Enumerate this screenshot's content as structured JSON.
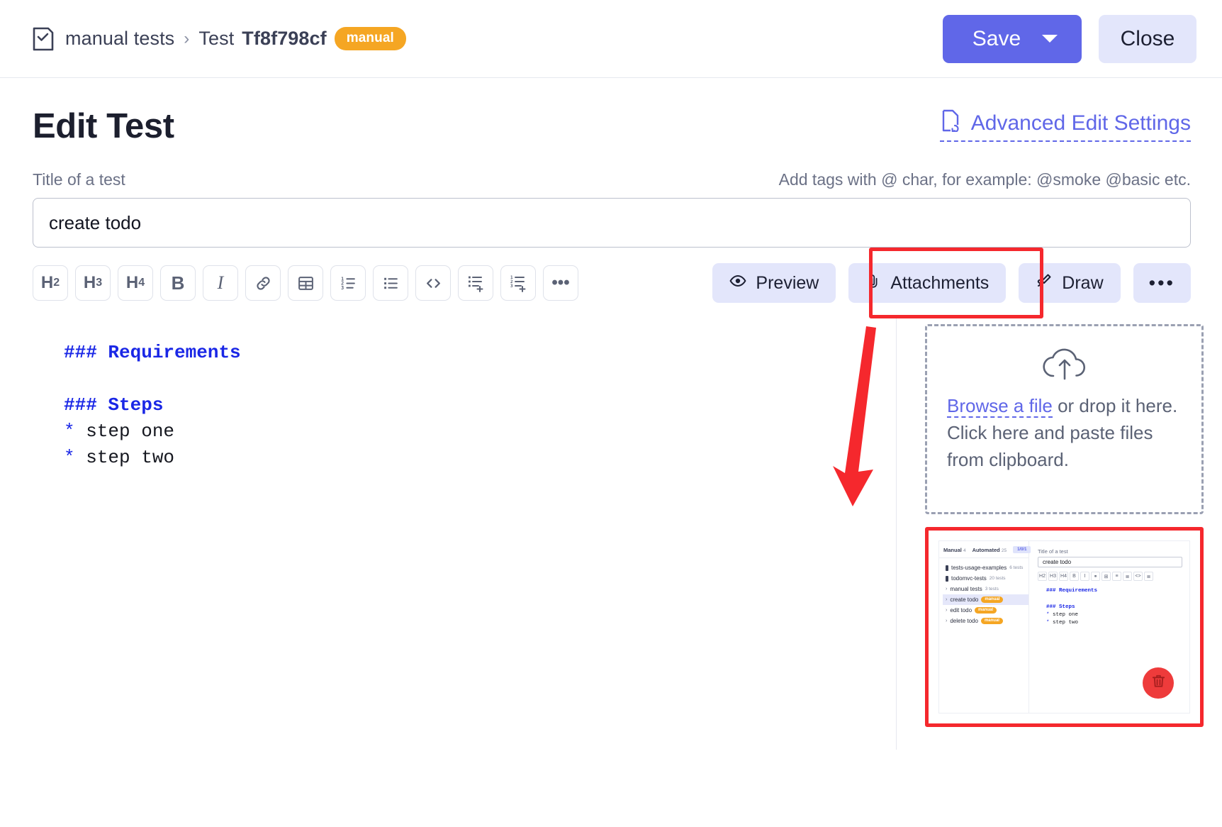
{
  "topbar": {
    "doc_icon": "checklist-doc-icon",
    "breadcrumb_root": "manual tests",
    "breadcrumb_sep": "›",
    "breadcrumb_test_prefix": "Test ",
    "breadcrumb_test_id": "Tf8f798cf",
    "badge": "manual",
    "save_label": "Save",
    "close_label": "Close",
    "save_color": "#6067e8",
    "close_color": "#e3e6fb",
    "badge_color": "#f5a623"
  },
  "page": {
    "title": "Edit Test",
    "advanced_link": "Advanced Edit Settings",
    "advanced_icon": "file-sync-icon"
  },
  "form": {
    "title_label": "Title of a test",
    "tag_hint": "Add tags with @ char, for example: @smoke @basic etc.",
    "title_value": "create todo",
    "title_placeholder": "Title of a test"
  },
  "toolbar": {
    "markdown_buttons": [
      {
        "name": "heading-2-button",
        "label": "H",
        "sub": "2"
      },
      {
        "name": "heading-3-button",
        "label": "H",
        "sub": "3"
      },
      {
        "name": "heading-4-button",
        "label": "H",
        "sub": "4"
      },
      {
        "name": "bold-button",
        "label": "B",
        "sub": ""
      },
      {
        "name": "italic-button",
        "label": "I",
        "sub": ""
      },
      {
        "name": "link-button",
        "label": "",
        "sub": ""
      },
      {
        "name": "table-button",
        "label": "",
        "sub": ""
      },
      {
        "name": "ordered-list-button",
        "label": "",
        "sub": ""
      },
      {
        "name": "unordered-list-button",
        "label": "",
        "sub": ""
      },
      {
        "name": "code-button",
        "label": "",
        "sub": ""
      },
      {
        "name": "add-unordered-list-button",
        "label": "",
        "sub": ""
      },
      {
        "name": "add-ordered-list-button",
        "label": "",
        "sub": ""
      },
      {
        "name": "more-tools-button",
        "label": "•••",
        "sub": ""
      }
    ],
    "preview_label": "Preview",
    "attachments_label": "Attachments",
    "draw_label": "Draw",
    "more_label": "•••",
    "highlight_color": "#f5282d"
  },
  "editor": {
    "lines": [
      {
        "type": "heading",
        "hashes": "### ",
        "text": "Requirements"
      },
      {
        "type": "blank",
        "text": ""
      },
      {
        "type": "heading",
        "hashes": "### ",
        "text": "Steps"
      },
      {
        "type": "bullet",
        "marker": "* ",
        "text": "step one"
      },
      {
        "type": "bullet",
        "marker": "* ",
        "text": "step two"
      }
    ]
  },
  "dropzone": {
    "icon": "cloud-upload-icon",
    "browse_link": "Browse a file",
    "drop_text": "or drop it here.",
    "paste_text": "Click here and paste files from clipboard."
  },
  "attachment_thumbnail": {
    "tabs": [
      {
        "label": "Manual",
        "count": "4"
      },
      {
        "label": "Automated",
        "count": "25"
      }
    ],
    "tab_pill": "1/0/1",
    "tree": [
      {
        "caret": "",
        "square": true,
        "name": "tests-usage-examples",
        "count": "6 tests",
        "badge": "",
        "selected": false
      },
      {
        "caret": "",
        "square": true,
        "name": "todomvc-tests",
        "count": "20 tests",
        "badge": "",
        "selected": false
      },
      {
        "caret": "›",
        "square": false,
        "name": "manual tests",
        "count": "3 tests",
        "badge": "",
        "selected": false
      },
      {
        "caret": "›",
        "square": false,
        "name": "create todo",
        "count": "",
        "badge": "manual",
        "selected": true
      },
      {
        "caret": "›",
        "square": false,
        "name": "edit todo",
        "count": "",
        "badge": "manual",
        "selected": false
      },
      {
        "caret": "›",
        "square": false,
        "name": "delete todo",
        "count": "",
        "badge": "manual",
        "selected": false
      }
    ],
    "title_label": "Title of a test",
    "title_value": "create todo",
    "tools": [
      "H2",
      "H3",
      "H4",
      "B",
      "I",
      "⚭",
      "⊞",
      "≡",
      "≣",
      "<>",
      "≣"
    ],
    "md_lines": [
      {
        "type": "heading",
        "hashes": "### ",
        "text": "Requirements"
      },
      {
        "type": "blank",
        "text": ""
      },
      {
        "type": "heading",
        "hashes": "### ",
        "text": "Steps"
      },
      {
        "type": "bullet",
        "marker": "* ",
        "text": "step one"
      },
      {
        "type": "bullet",
        "marker": "* ",
        "text": "step two"
      }
    ],
    "delete_icon": "trash-icon",
    "delete_color": "#ee3b3b",
    "highlight_color": "#f5282d"
  },
  "annotation": {
    "arrow_color": "#f5282d"
  }
}
